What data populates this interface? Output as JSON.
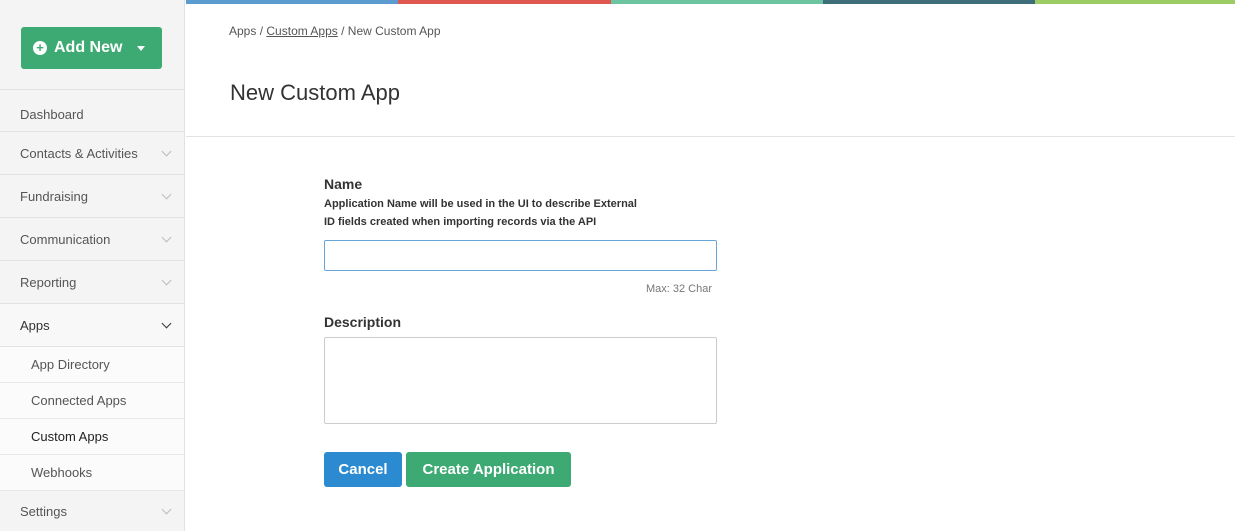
{
  "sidebar": {
    "add_new_label": "Add New",
    "items": [
      {
        "label": "Dashboard"
      },
      {
        "label": "Contacts & Activities"
      },
      {
        "label": "Fundraising"
      },
      {
        "label": "Communication"
      },
      {
        "label": "Reporting"
      },
      {
        "label": "Apps"
      }
    ],
    "apps_subitems": [
      {
        "label": "App Directory"
      },
      {
        "label": "Connected Apps"
      },
      {
        "label": "Custom Apps"
      },
      {
        "label": "Webhooks"
      }
    ],
    "settings_label": "Settings"
  },
  "colors": {
    "top_bar": [
      "#5b9bd0",
      "#e0574f",
      "#6cc4a1",
      "#3d6e7a",
      "#9ccc63"
    ],
    "primary": "#2b8ad0",
    "success": "#3eaa73"
  },
  "breadcrumb": {
    "root": "Apps",
    "sep1": "/",
    "parent": "Custom Apps",
    "sep2": "/",
    "current": "New Custom App"
  },
  "page": {
    "title": "New Custom App"
  },
  "form": {
    "name_label": "Name",
    "name_help_line1": "Application Name will be used in the UI to describe External",
    "name_help_line2": "ID fields created when importing records via the API",
    "name_value": "",
    "name_max": "Max: 32 Char",
    "description_label": "Description",
    "description_value": "",
    "cancel_label": "Cancel",
    "create_label": "Create Application"
  }
}
